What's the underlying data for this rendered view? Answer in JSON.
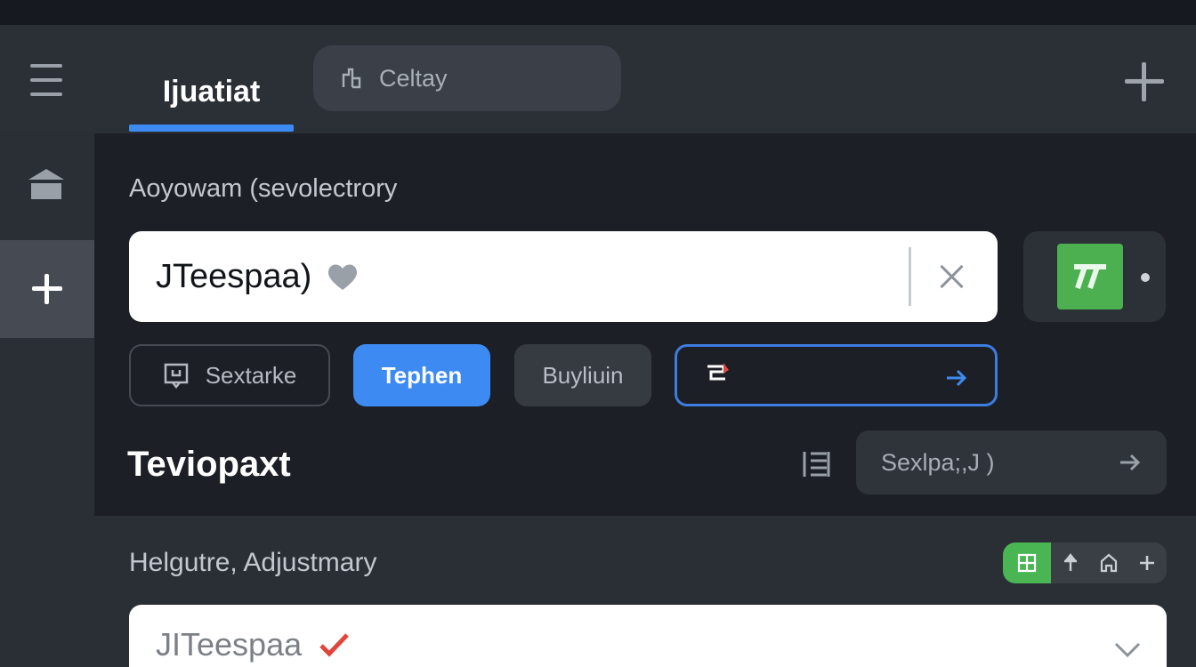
{
  "header": {
    "tabs": [
      {
        "label": "Ijuatiat",
        "active": true
      },
      {
        "label": "Celtay",
        "active": false
      }
    ]
  },
  "form": {
    "section_label": "Aoyowam (sevolectrory",
    "search_value": "JTeespaa)",
    "chips": {
      "outline": "Sextarke",
      "primary": "Tephen",
      "gray": "Buyliuin"
    },
    "subtitle": "Teviopaxt",
    "search_pill": "Sexlpa;,J )"
  },
  "lower": {
    "label": "Helgutre, Adjustmary",
    "select_value": "JITeespaa"
  },
  "colors": {
    "accent": "#3d8bf2",
    "green": "#4cb050",
    "check_red": "#e0463c"
  },
  "icons": {
    "menu": "hamburger-icon",
    "home": "home-icon",
    "add": "plus-icon",
    "clear": "close-icon",
    "heart": "heart-icon",
    "app": "app-icon",
    "list": "list-icon",
    "arrow": "arrow-right-icon",
    "check": "check-icon",
    "chevron": "chevron-down-icon"
  }
}
